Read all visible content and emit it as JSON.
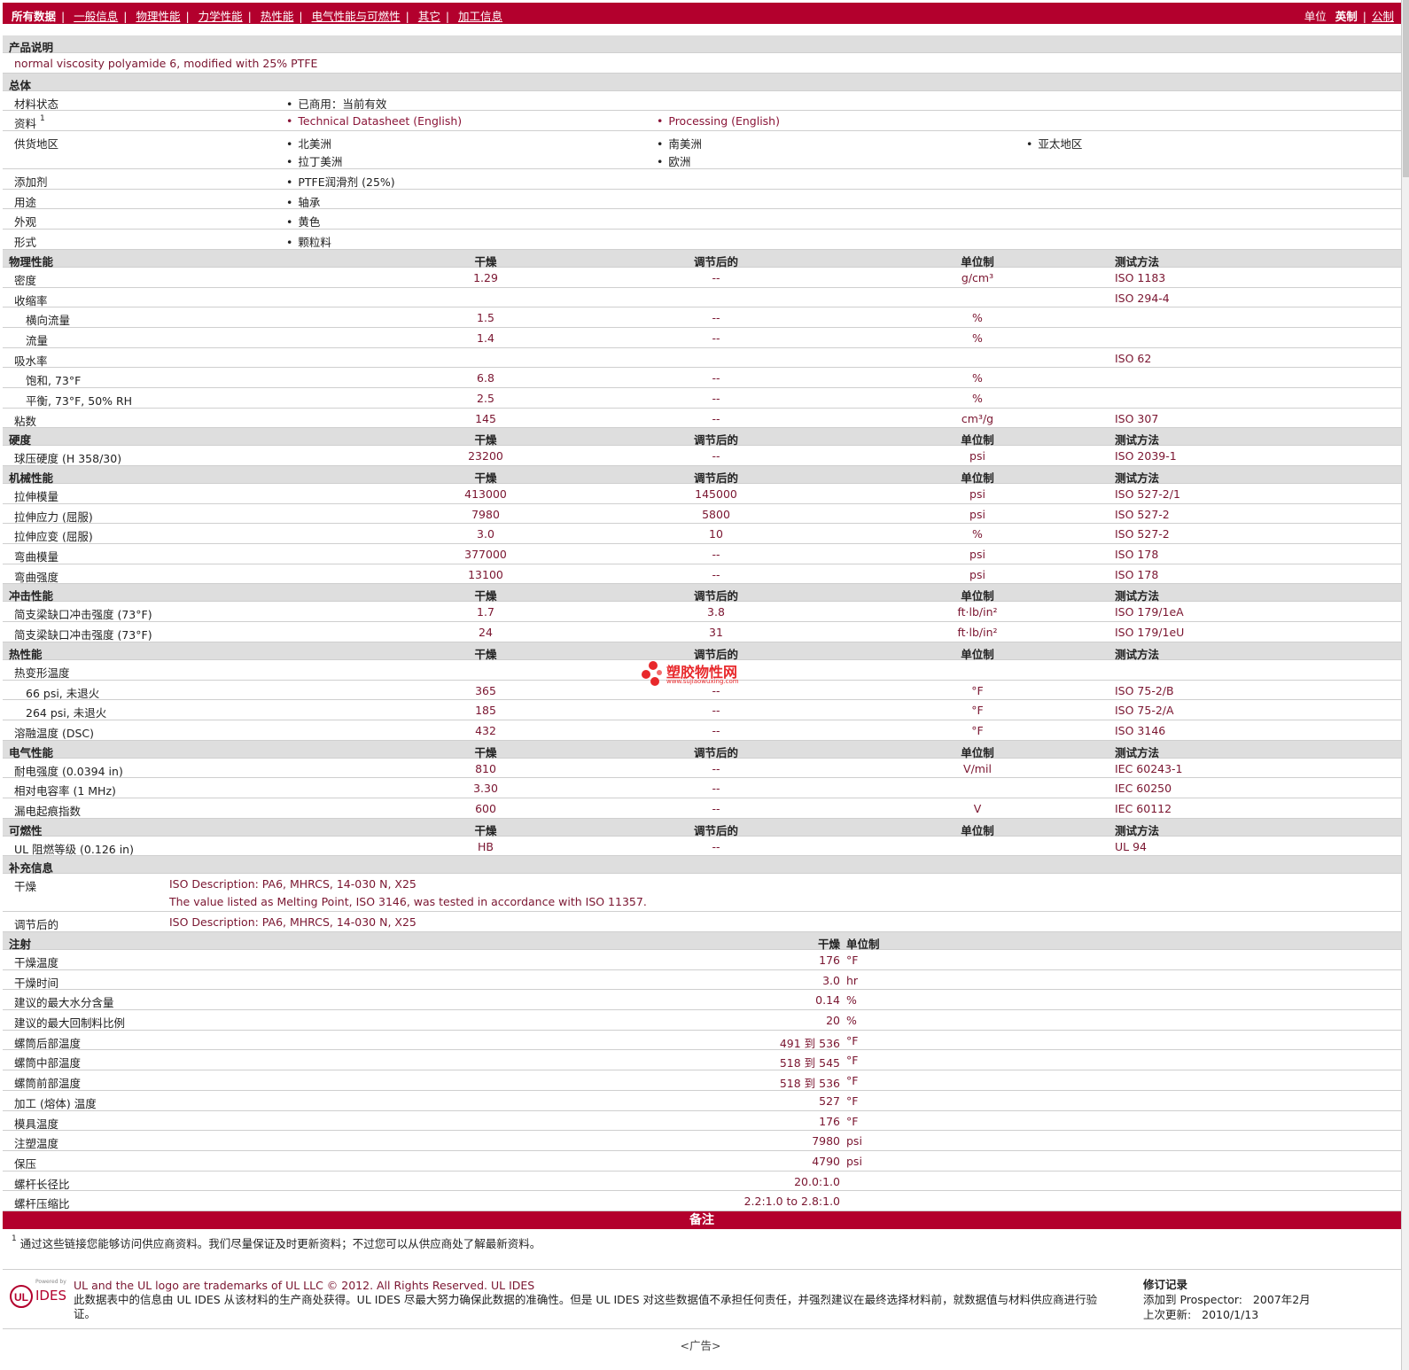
{
  "nav": {
    "current": "所有数据",
    "tabs": [
      "一般信息",
      "物理性能",
      "力学性能",
      "热性能",
      "电气性能与可燃性",
      "其它",
      "加工信息"
    ],
    "units_label": "单位",
    "units_current": "英制",
    "units_alt": "公制"
  },
  "product": {
    "title": "产品说明",
    "desc": "normal viscosity polyamide 6, modified with 25% PTFE"
  },
  "general": {
    "title": "总体",
    "status_label": "材料状态",
    "status": "已商用：当前有效",
    "docs_label": "资料",
    "docs_sup": "1",
    "doc1": "Technical Datasheet (English)",
    "doc2": "Processing (English)",
    "region_label": "供货地区",
    "r1": "北美洲",
    "r2": "南美洲",
    "r3": "亚太地区",
    "r4": "拉丁美洲",
    "r5": "欧洲",
    "additive_label": "添加剂",
    "additive": "PTFE润滑剂 (25%)",
    "use_label": "用途",
    "use": "轴承",
    "appearance_label": "外观",
    "appearance": "黄色",
    "form_label": "形式",
    "form": "颗粒料"
  },
  "hdr": {
    "dry": "干燥",
    "cond": "调节后的",
    "unit": "单位制",
    "method": "测试方法"
  },
  "physical": {
    "title": "物理性能",
    "rows": [
      {
        "label": "密度",
        "dry": "1.29",
        "cond": "--",
        "unit": "g/cm³",
        "method": "ISO 1183",
        "ind": false
      },
      {
        "label": "收缩率",
        "dry": "",
        "cond": "",
        "unit": "",
        "method": "ISO 294-4",
        "ind": false
      },
      {
        "label": "横向流量",
        "dry": "1.5",
        "cond": "--",
        "unit": "%",
        "method": "",
        "ind": true
      },
      {
        "label": "流量",
        "dry": "1.4",
        "cond": "--",
        "unit": "%",
        "method": "",
        "ind": true
      },
      {
        "label": "吸水率",
        "dry": "",
        "cond": "",
        "unit": "",
        "method": "ISO 62",
        "ind": false
      },
      {
        "label": "饱和, 73°F",
        "dry": "6.8",
        "cond": "--",
        "unit": "%",
        "method": "",
        "ind": true
      },
      {
        "label": "平衡, 73°F, 50% RH",
        "dry": "2.5",
        "cond": "--",
        "unit": "%",
        "method": "",
        "ind": true
      },
      {
        "label": "粘数",
        "dry": "145",
        "cond": "--",
        "unit": "cm³/g",
        "method": "ISO 307",
        "ind": false
      }
    ]
  },
  "hardness": {
    "title": "硬度",
    "rows": [
      {
        "label": "球压硬度 (H 358/30)",
        "dry": "23200",
        "cond": "--",
        "unit": "psi",
        "method": "ISO 2039-1",
        "ind": false
      }
    ]
  },
  "mechanical": {
    "title": "机械性能",
    "rows": [
      {
        "label": "拉伸模量",
        "dry": "413000",
        "cond": "145000",
        "unit": "psi",
        "method": "ISO 527-2/1",
        "ind": false
      },
      {
        "label": "拉伸应力 (屈服)",
        "dry": "7980",
        "cond": "5800",
        "unit": "psi",
        "method": "ISO 527-2",
        "ind": false
      },
      {
        "label": "拉伸应变 (屈服)",
        "dry": "3.0",
        "cond": "10",
        "unit": "%",
        "method": "ISO 527-2",
        "ind": false
      },
      {
        "label": "弯曲模量",
        "dry": "377000",
        "cond": "--",
        "unit": "psi",
        "method": "ISO 178",
        "ind": false
      },
      {
        "label": "弯曲强度",
        "dry": "13100",
        "cond": "--",
        "unit": "psi",
        "method": "ISO 178",
        "ind": false
      }
    ]
  },
  "impact": {
    "title": "冲击性能",
    "rows": [
      {
        "label": "简支梁缺口冲击强度 (73°F)",
        "dry": "1.7",
        "cond": "3.8",
        "unit": "ft·lb/in²",
        "method": "ISO 179/1eA",
        "ind": false
      },
      {
        "label": "简支梁缺口冲击强度 (73°F)",
        "dry": "24",
        "cond": "31",
        "unit": "ft·lb/in²",
        "method": "ISO 179/1eU",
        "ind": false
      }
    ]
  },
  "thermal": {
    "title": "热性能",
    "rows": [
      {
        "label": "热变形温度",
        "dry": "",
        "cond": "",
        "unit": "",
        "method": "",
        "ind": false
      },
      {
        "label": "66 psi, 未退火",
        "dry": "365",
        "cond": "--",
        "unit": "°F",
        "method": "ISO 75-2/B",
        "ind": true
      },
      {
        "label": "264 psi, 未退火",
        "dry": "185",
        "cond": "--",
        "unit": "°F",
        "method": "ISO 75-2/A",
        "ind": true
      },
      {
        "label": "溶融温度 (DSC)",
        "dry": "432",
        "cond": "--",
        "unit": "°F",
        "method": "ISO 3146",
        "ind": false
      }
    ]
  },
  "electrical": {
    "title": "电气性能",
    "rows": [
      {
        "label": "耐电强度 (0.0394 in)",
        "dry": "810",
        "cond": "--",
        "unit": "V/mil",
        "method": "IEC 60243-1",
        "ind": false
      },
      {
        "label": "相对电容率 (1 MHz)",
        "dry": "3.30",
        "cond": "--",
        "unit": "",
        "method": "IEC 60250",
        "ind": false
      },
      {
        "label": "漏电起痕指数",
        "dry": "600",
        "cond": "--",
        "unit": "V",
        "method": "IEC 60112",
        "ind": false
      }
    ]
  },
  "flammability": {
    "title": "可燃性",
    "rows": [
      {
        "label": "UL 阻燃等级 (0.126 in)",
        "dry": "HB",
        "cond": "--",
        "unit": "",
        "method": "UL 94",
        "ind": false
      }
    ]
  },
  "supplement": {
    "title": "补充信息",
    "dry_label": "干燥",
    "dry1": "ISO Description: PA6, MHRCS, 14-030 N, X25",
    "dry2": "The value listed as Melting Point, ISO 3146, was tested in accordance with ISO 11357.",
    "cond_label": "调节后的",
    "cond1": "ISO Description: PA6, MHRCS, 14-030 N, X25"
  },
  "injection": {
    "title": "注射",
    "dry": "干燥",
    "unit": "单位制",
    "rows": [
      {
        "label": "干燥温度",
        "val": "176",
        "unit": "°F"
      },
      {
        "label": "干燥时间",
        "val": "3.0",
        "unit": "hr"
      },
      {
        "label": "建议的最大水分含量",
        "val": "0.14",
        "unit": "%"
      },
      {
        "label": "建议的最大回制料比例",
        "val": "20",
        "unit": "%"
      },
      {
        "label": "螺筒后部温度",
        "val": "491 到  536",
        "unit": "°F"
      },
      {
        "label": "螺筒中部温度",
        "val": "518 到  545",
        "unit": "°F"
      },
      {
        "label": "螺筒前部温度",
        "val": "518 到  536",
        "unit": "°F"
      },
      {
        "label": "加工 (熔体) 温度",
        "val": "527",
        "unit": "°F"
      },
      {
        "label": "模具温度",
        "val": "176",
        "unit": "°F"
      },
      {
        "label": "注塑温度",
        "val": "7980",
        "unit": "psi"
      },
      {
        "label": "保压",
        "val": "4790",
        "unit": "psi"
      },
      {
        "label": "螺杆长径比",
        "val": "20.0:1.0",
        "unit": ""
      },
      {
        "label": "螺杆压缩比",
        "val": "2.2:1.0 to 2.8:1.0",
        "unit": ""
      }
    ]
  },
  "notes": {
    "title": "备注",
    "sup": "1",
    "text": "通过这些链接您能够访问供应商资料。我们尽量保证及时更新资料；不过您可以从供应商处了解最新资料。"
  },
  "footer": {
    "logo_small": "Powered by",
    "logo_text": "IDES",
    "line1": "UL and the UL logo are trademarks of UL LLC © 2012. All Rights Reserved. UL IDES",
    "line2": "此数据表中的信息由  UL IDES 从该材料的生产商处获得。UL IDES 尽最大努力确保此数据的准确性。但是  UL IDES 对这些数据值不承担任何责任，并强烈建议在最终选择材料前，就数据值与材料供应商进行验证。",
    "rev_title": "修订记录",
    "added_label": "添加到  Prospector:",
    "added": "2007年2月",
    "updated_label": "上次更新:",
    "updated": "2010/1/13"
  },
  "ad": "<广告>",
  "watermark": {
    "name": "塑胶物性网",
    "url": "www.sujiaowuxing.com"
  },
  "colors": {
    "brand": "#b3002d",
    "section": "#dedede"
  }
}
